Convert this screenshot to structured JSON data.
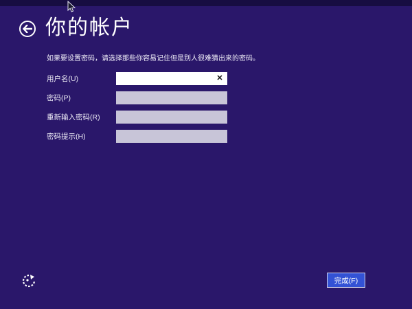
{
  "page": {
    "title": "你的帐户",
    "instruction": "如果要设置密码，请选择那些你容易记住但是别人很难猜出来的密码。"
  },
  "back_button": {
    "icon": "back-arrow-icon"
  },
  "form": {
    "fields": [
      {
        "label": "用户名(U)",
        "value": "",
        "placeholder": "",
        "state": "focused",
        "clear_icon": "✕"
      },
      {
        "label": "密码(P)",
        "value": "",
        "placeholder": "",
        "state": "idle"
      },
      {
        "label": "重新输入密码(R)",
        "value": "",
        "placeholder": "",
        "state": "idle"
      },
      {
        "label": "密码提示(H)",
        "value": "",
        "placeholder": "",
        "state": "idle"
      }
    ]
  },
  "footer": {
    "ease_of_access_icon": "ease-of-access-icon",
    "finish_label": "完成(F)"
  },
  "colors": {
    "background": "#2a176a",
    "top_strip": "#170d41",
    "field_idle": "#c8c5d8",
    "field_focused": "#ffffff",
    "accent_button": "#3352d5",
    "button_border": "#d9d9ec",
    "text": "#ffffff"
  }
}
